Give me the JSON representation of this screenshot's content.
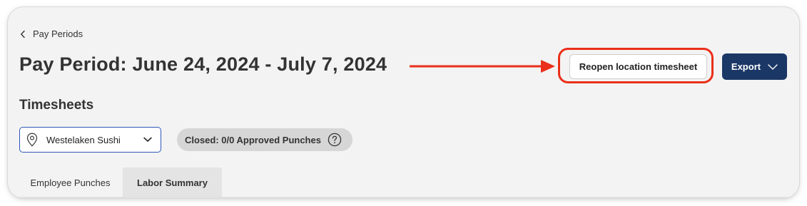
{
  "breadcrumb": {
    "back_label": "Pay Periods"
  },
  "header": {
    "title": "Pay Period: June 24, 2024 - July 7, 2024",
    "reopen_button_label": "Reopen location timesheet",
    "export_button_label": "Export"
  },
  "timesheets": {
    "section_title": "Timesheets",
    "location_select": {
      "selected_value": "Westelaken Sushi"
    },
    "status_pill": {
      "text": "Closed: 0/0 Approved Punches"
    }
  },
  "tabs": [
    {
      "label": "Employee Punches",
      "active": false
    },
    {
      "label": "Labor Summary",
      "active": true
    }
  ],
  "icons": {
    "back": "chevron-left-icon",
    "export_caret": "chevron-down-icon",
    "location": "map-pin-icon",
    "select_caret": "chevron-down-icon",
    "help": "question-circle-icon",
    "annotation": "arrow-right-icon"
  },
  "colors": {
    "primary_button": "#1b3766",
    "annotation_red": "#ea2f1a",
    "focus_border": "#2e56b8",
    "pill_background": "#d6d6d6"
  }
}
